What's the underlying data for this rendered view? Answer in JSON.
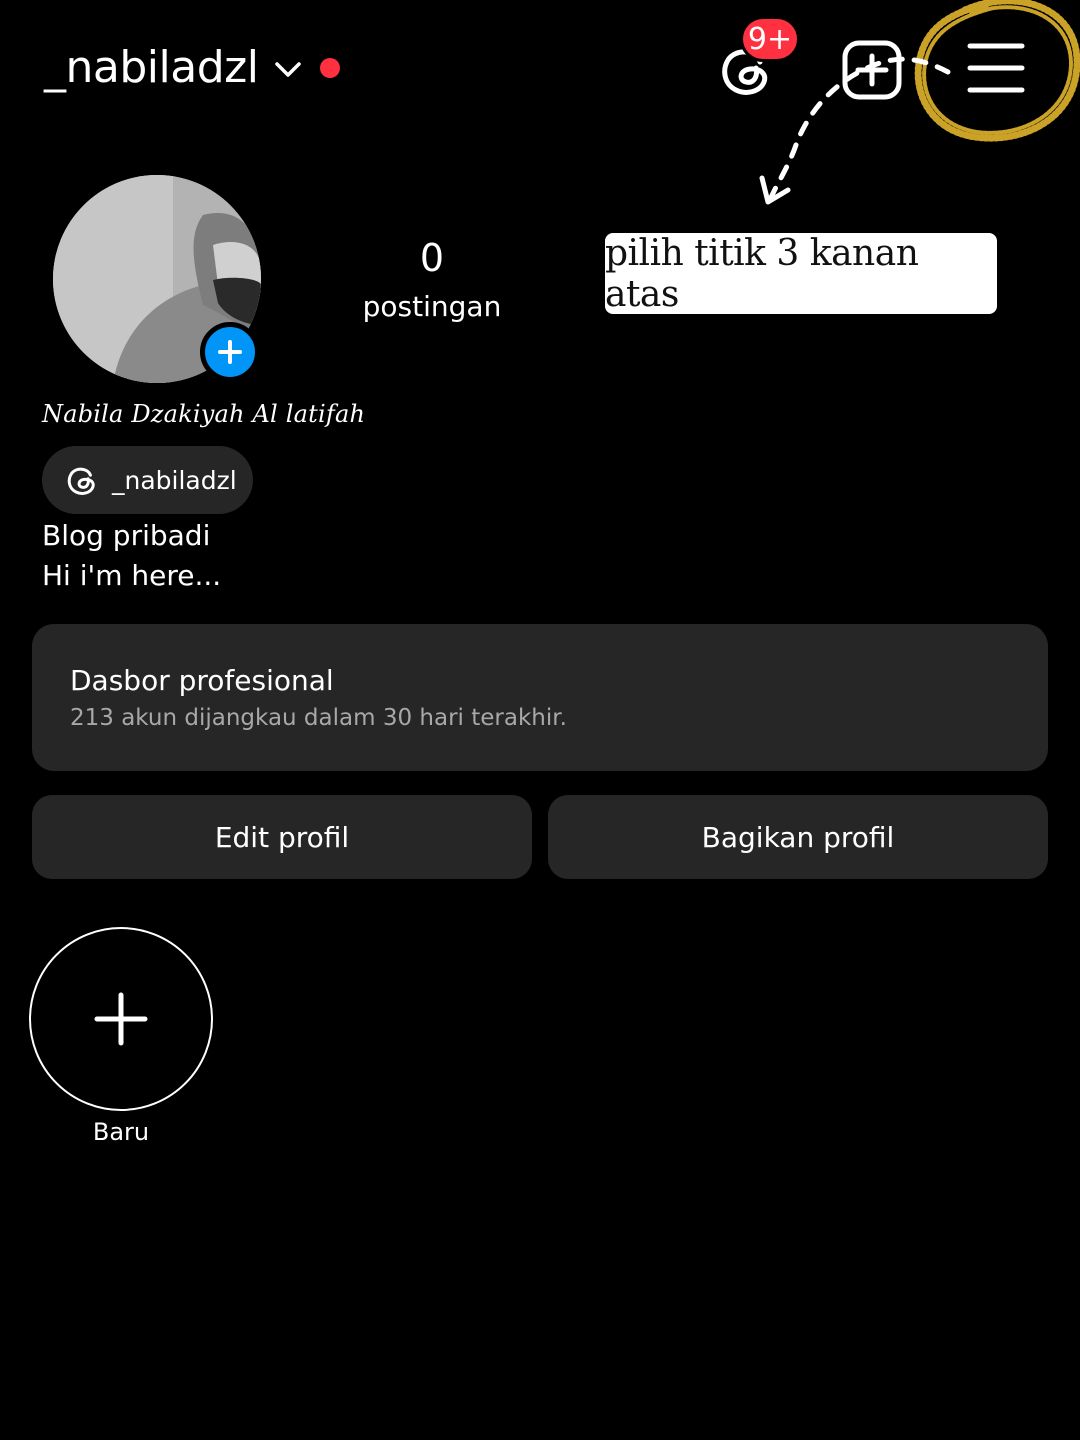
{
  "header": {
    "username": "_nabiladzl",
    "notification_badge": "9+",
    "live_dot_color": "#ff3040",
    "badge_color": "#ff3040"
  },
  "annotation": {
    "note_text": "pilih titik 3 kanan atas",
    "circle_color": "#c9a227"
  },
  "profile": {
    "add_story_color": "#0095f6",
    "stats": [
      {
        "value": "0",
        "label": "postingan"
      }
    ],
    "full_name": "Nabila Dzakiyah Al latifah",
    "threads_handle": "_nabiladzl",
    "category": "Blog pribadi",
    "bio": "Hi i'm here..."
  },
  "dashboard": {
    "title": "Dasbor profesional",
    "subtitle": "213 akun dijangkau dalam 30 hari terakhir."
  },
  "actions": {
    "edit_label": "Edit profil",
    "share_label": "Bagikan profil"
  },
  "highlights": {
    "new_label": "Baru"
  },
  "icons": [
    "chevron-down-icon",
    "threads-icon",
    "add-post-icon",
    "hamburger-menu-icon",
    "plus-icon"
  ]
}
